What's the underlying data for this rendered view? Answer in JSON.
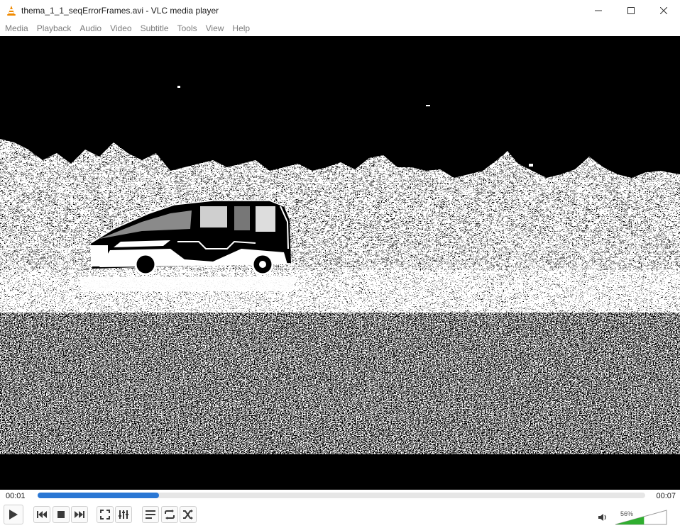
{
  "window": {
    "title": "thema_1_1_seqErrorFrames.avi - VLC media player",
    "app_icon": "vlc-cone-icon",
    "controls": [
      "minimize-icon",
      "maximize-icon",
      "close-icon"
    ]
  },
  "menu": {
    "items": [
      "Media",
      "Playback",
      "Audio",
      "Video",
      "Subtitle",
      "Tools",
      "View",
      "Help"
    ]
  },
  "player": {
    "time_elapsed": "00:01",
    "time_total": "00:07",
    "seek_progress": 0.2,
    "accent_color": "#2a77d4",
    "volume_label": "56%",
    "volume_level": 0.56,
    "volume_color": "#2fae2f"
  },
  "controls": {
    "buttons": [
      "play-icon",
      "previous-icon",
      "stop-icon",
      "next-icon",
      "fullscreen-icon",
      "extended-settings-icon",
      "playlist-icon",
      "loop-icon",
      "shuffle-icon"
    ],
    "volume_icon": "speaker-icon"
  }
}
